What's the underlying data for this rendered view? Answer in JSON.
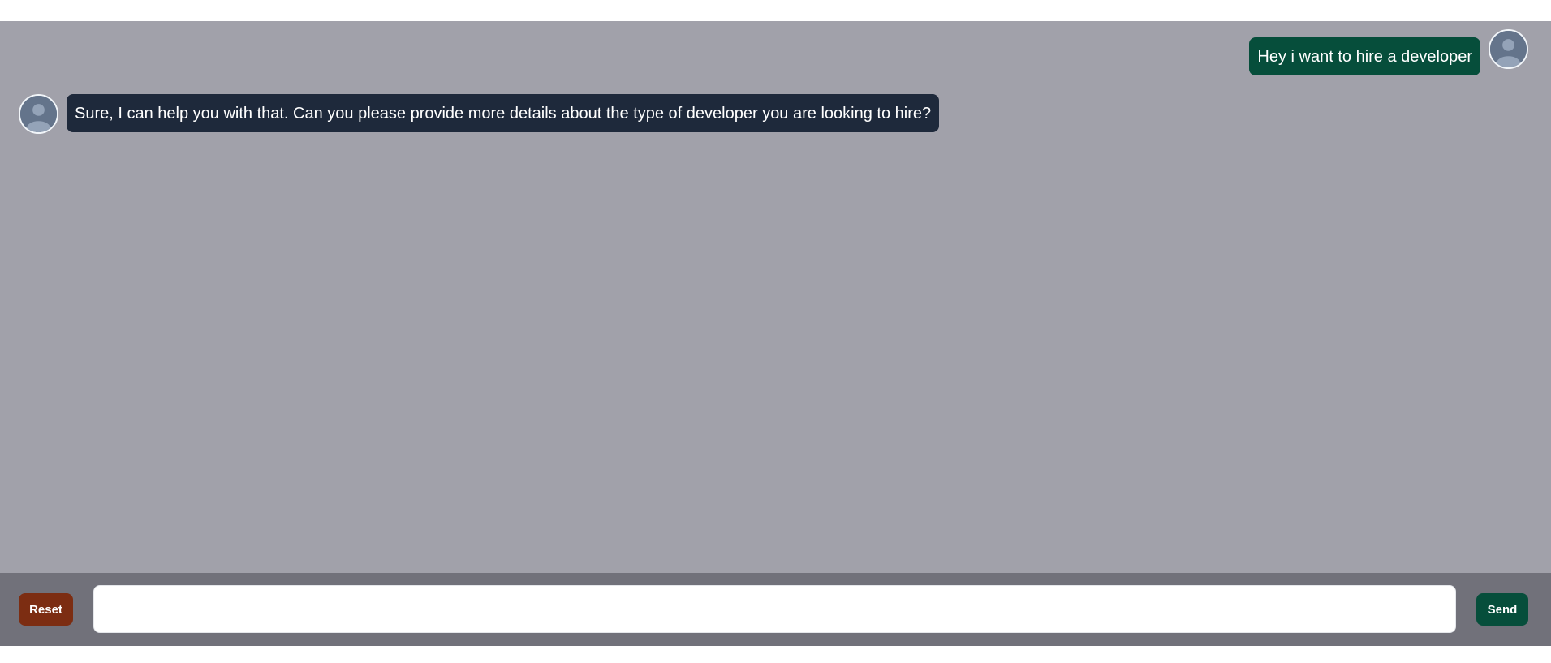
{
  "chat": {
    "messages": [
      {
        "sender": "user",
        "text": "Hey i want to hire a developer",
        "avatar_icon": "user-avatar-icon"
      },
      {
        "sender": "bot",
        "text": "Sure, I can help you with that. Can you please provide more details about the type of developer you are looking to hire?",
        "avatar_icon": "user-avatar-icon"
      }
    ]
  },
  "composer": {
    "reset_label": "Reset",
    "send_label": "Send",
    "input_value": "",
    "input_placeholder": ""
  },
  "colors": {
    "chat_background": "#a1a1aa",
    "composer_background": "#71717a",
    "user_bubble": "#064e3b",
    "bot_bubble": "#1e293b",
    "reset_button": "#7c2d12",
    "send_button": "#064e3b",
    "avatar_fill": "#64748b"
  }
}
